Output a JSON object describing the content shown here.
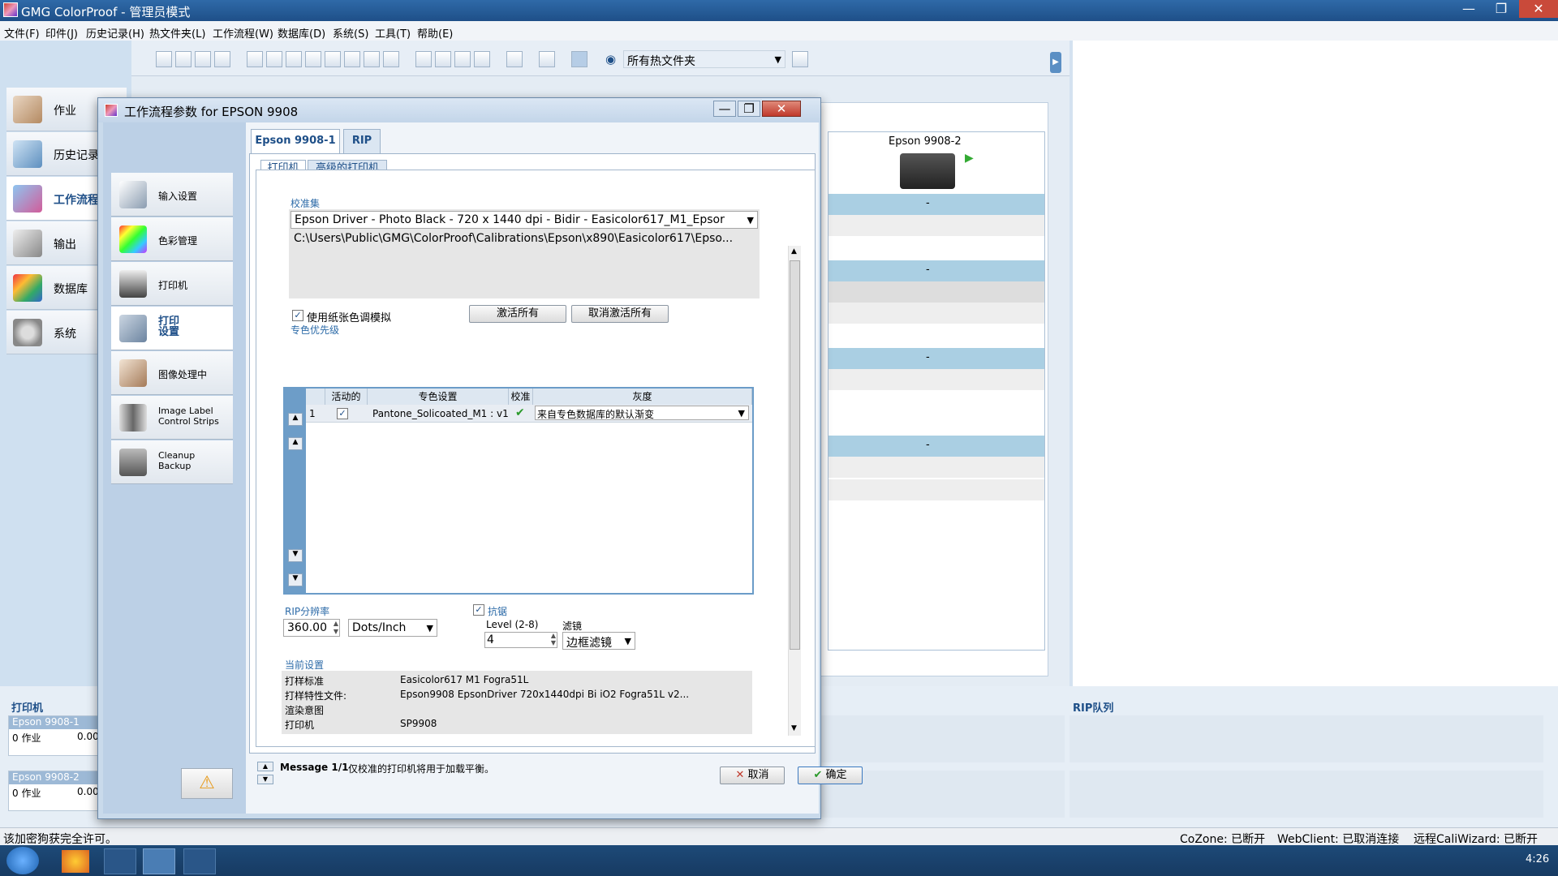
{
  "app": {
    "title": "GMG ColorProof - 管理员模式"
  },
  "menu": [
    "文件(F)",
    "印件(J)",
    "历史记录(H)",
    "热文件夹(L)",
    "工作流程(W)",
    "数据库(D)",
    "系统(S)",
    "工具(T)",
    "帮助(E)"
  ],
  "leftnav": [
    {
      "label": "作业",
      "icon": "job-icon"
    },
    {
      "label": "历史记录",
      "icon": "history-icon"
    },
    {
      "label": "工作流程",
      "icon": "workflow-icon",
      "selected": true
    },
    {
      "label": "输出",
      "icon": "output-icon"
    },
    {
      "label": "数据库",
      "icon": "database-icon"
    },
    {
      "label": "系统",
      "icon": "gears-icon"
    }
  ],
  "toolbar": {
    "hotfolder_select": "所有热文件夹"
  },
  "printer_panel": {
    "name": "Epson 9908-2",
    "rows": [
      "-",
      "-",
      "-",
      "-"
    ]
  },
  "bottom": {
    "printer_header": "打印机",
    "rip_queue": "RIP队列",
    "printers": [
      {
        "name": "Epson 9908-1",
        "jobs": "0 作业",
        "value": "0.00"
      },
      {
        "name": "Epson 9908-2",
        "jobs": "0 作业",
        "value": "0.00"
      }
    ]
  },
  "status": {
    "left": "该加密狗获完全许可。",
    "cozone": "CoZone: 已断开",
    "webclient": "WebClient: 已取消连接",
    "caliwizard": "远程CaliWizard: 已断开"
  },
  "taskbar": {
    "time": "4:26"
  },
  "dialog": {
    "title": "工作流程参数 for EPSON 9908",
    "categories": [
      {
        "label": "输入设置",
        "icon": "input-settings-icon"
      },
      {
        "label": "色彩管理",
        "icon": "color-cube-icon"
      },
      {
        "label": "打印机",
        "icon": "printer-icon"
      },
      {
        "label": "打印\n设置",
        "icon": "print-settings-icon",
        "selected": true
      },
      {
        "label": "图像处理中",
        "icon": "image-processing-icon"
      },
      {
        "label": "Image Label\nControl Strips",
        "icon": "control-strip-icon"
      },
      {
        "label": "Cleanup\nBackup",
        "icon": "cleanup-icon"
      }
    ],
    "tabs": [
      "Epson 9908-1",
      "RIP"
    ],
    "subtabs": [
      "打印机",
      "高级的打印机"
    ],
    "calibration": {
      "label": "校准集",
      "selected": "Epson Driver - Photo Black - 720 x 1440 dpi - Bidir - Easicolor617_M1_Epsor",
      "path": "C:\\Users\\Public\\GMG\\ColorProof\\Calibrations\\Epson\\x890\\Easicolor617\\Epso..."
    },
    "paper_sim": {
      "label": "使用纸张色调模拟",
      "checked": true
    },
    "activate_all": "激活所有",
    "deactivate_all": "取消激活所有",
    "spot_priority": "专色优先级",
    "grid": {
      "headers": [
        "活动的",
        "专色设置",
        "校准",
        "灰度"
      ],
      "rows": [
        {
          "index": "1",
          "active": true,
          "spot": "Pantone_Solicoated_M1 : v1",
          "calibrated": true,
          "gray": "来自专色数据库的默认渐变"
        }
      ]
    },
    "rip_res": {
      "label": "RIP分辨率",
      "value": "360.00",
      "unit": "Dots/Inch"
    },
    "antialias": {
      "label": "抗锯",
      "checked": true,
      "level_label": "Level (2-8)",
      "level": "4",
      "filter_label": "滤镜",
      "filter": "边框滤镜"
    },
    "current_settings": {
      "label": "当前设置",
      "rows": [
        {
          "k": "打样标准",
          "v": "Easicolor617  M1  Fogra51L"
        },
        {
          "k": "打样特性文件:",
          "v": "Epson9908  EpsonDriver  720x1440dpi  Bi  iO2  Fogra51L  v2..."
        },
        {
          "k": "渲染意图",
          "v": ""
        },
        {
          "k": "打印机",
          "v": "SP9908"
        }
      ]
    },
    "message": {
      "title": "Message 1/1",
      "text": "仅校准的打印机将用于加载平衡。"
    },
    "cancel": "取消",
    "ok": "确定"
  }
}
